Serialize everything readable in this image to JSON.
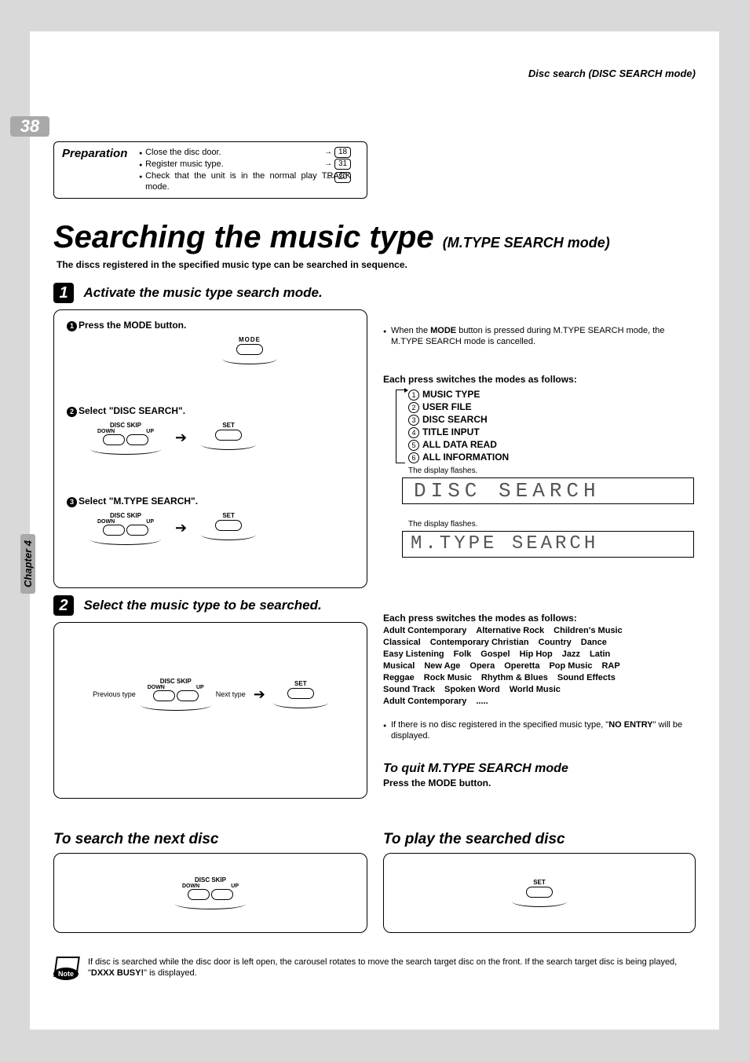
{
  "header": {
    "right": "Disc search (DISC SEARCH mode)"
  },
  "page_number": "38",
  "chapter_tab": "Chapter 4",
  "preparation": {
    "title": "Preparation",
    "items": [
      {
        "text": "Close the disc door.",
        "ref": "18"
      },
      {
        "text": "Register music type.",
        "ref": "31"
      },
      {
        "text": "Check that the unit is in the normal play TRACK mode.",
        "ref": "20"
      }
    ]
  },
  "main_title": "Searching the music type",
  "main_subtitle": "(M.TYPE SEARCH  mode)",
  "intro": "The discs registered in the specified music type can be searched in sequence.",
  "step1": {
    "num": "1",
    "title": "Activate the music type search mode.",
    "sub1_num": "1",
    "sub1": "Press the MODE button.",
    "mode_label": "MODE",
    "sub2_num": "2",
    "sub2": "Select \"DISC SEARCH\".",
    "disc_skip": "DISC SKIP",
    "down": "DOWN",
    "up": "UP",
    "set": "SET",
    "sub3_num": "3",
    "sub3": "Select \"M.TYPE SEARCH\"."
  },
  "step2": {
    "num": "2",
    "title": "Select the music type to be searched.",
    "prev": "Previous type",
    "next": "Next type"
  },
  "right1": {
    "note": "When the MODE button is pressed during M.TYPE SEARCH mode, the M.TYPE SEARCH mode is cancelled.",
    "bold_word": "MODE",
    "modes_title": "Each press switches the modes as follows:",
    "modes": [
      "MUSIC TYPE",
      "USER FILE",
      "DISC SEARCH",
      "TITLE INPUT",
      "ALL DATA READ",
      "ALL INFORMATION"
    ],
    "flash": "The display flashes.",
    "lcd1": "DISC SEARCH",
    "lcd2": "M.TYPE SEARCH"
  },
  "right2": {
    "modes_title": "Each press switches the modes as follows:",
    "genres": [
      "Adult Contemporary",
      "Alternative Rock",
      "Children's Music",
      "Classical",
      "Contemporary Christian",
      "Country",
      "Dance",
      "Easy Listening",
      "Folk",
      "Gospel",
      "Hip Hop",
      "Jazz",
      "Latin",
      "Musical",
      "New Age",
      "Opera",
      "Operetta",
      "Pop Music",
      "RAP",
      "Reggae",
      "Rock Music",
      "Rhythm & Blues",
      "Sound Effects",
      "Sound Track",
      "Spoken Word",
      "World Music",
      "Adult Contemporary",
      "....."
    ],
    "no_entry_pre": "If there is no disc registered in the specified music type, \"",
    "no_entry_bold": "NO ENTRY",
    "no_entry_post": "\" will be displayed.",
    "quit_title": "To quit M.TYPE SEARCH mode",
    "quit_sub": "Press the MODE button."
  },
  "search_next": {
    "title": "To search the next disc"
  },
  "play_searched": {
    "title": "To play the searched disc"
  },
  "footer_note": {
    "pre": "If disc is searched while the disc door is left open, the carousel rotates to move the search target disc on the front. If the search target disc is being played, \"",
    "bold": "DXXX BUSY!",
    "post": "\" is displayed.",
    "badge": "Note"
  }
}
